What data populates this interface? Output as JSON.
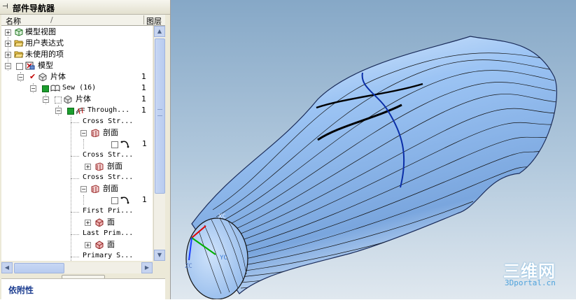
{
  "navigator": {
    "title": "部件导航器",
    "pin_glyph": "⊣",
    "columns": {
      "name": "名称",
      "sort_mark": "/",
      "layer": "图层"
    },
    "tree": [
      {
        "label": "模型视图",
        "count": ""
      },
      {
        "label": "用户表达式",
        "count": ""
      },
      {
        "label": "未使用的项",
        "count": ""
      },
      {
        "label": "模型",
        "count": ""
      },
      {
        "label": "片体",
        "count": "1"
      },
      {
        "label": "Sew (16)",
        "count": "1"
      },
      {
        "label": "片体",
        "count": "1"
      },
      {
        "label": "Through...",
        "count": "1"
      },
      {
        "label": "Cross Str...",
        "count": ""
      },
      {
        "label": "剖面",
        "count": ""
      },
      {
        "label": "",
        "count": "1"
      },
      {
        "label": "Cross Str...",
        "count": ""
      },
      {
        "label": "剖面",
        "count": ""
      },
      {
        "label": "Cross Str...",
        "count": ""
      },
      {
        "label": "剖面",
        "count": ""
      },
      {
        "label": "",
        "count": "1"
      },
      {
        "label": "First Pri...",
        "count": ""
      },
      {
        "label": "面",
        "count": ""
      },
      {
        "label": "Last Prim...",
        "count": ""
      },
      {
        "label": "面",
        "count": ""
      },
      {
        "label": "Primary S...",
        "count": ""
      }
    ],
    "dependency_title": "依附性"
  },
  "viewport": {
    "axes": {
      "x": "XC",
      "y": "YC",
      "z": "ZC"
    },
    "watermark": {
      "big": "三维网",
      "small": "3Dportal.cn"
    }
  },
  "colors": {
    "sky_top": "#86a8c7",
    "surface": "#9cc4f4",
    "iso_curve": "#0b2fa8"
  }
}
